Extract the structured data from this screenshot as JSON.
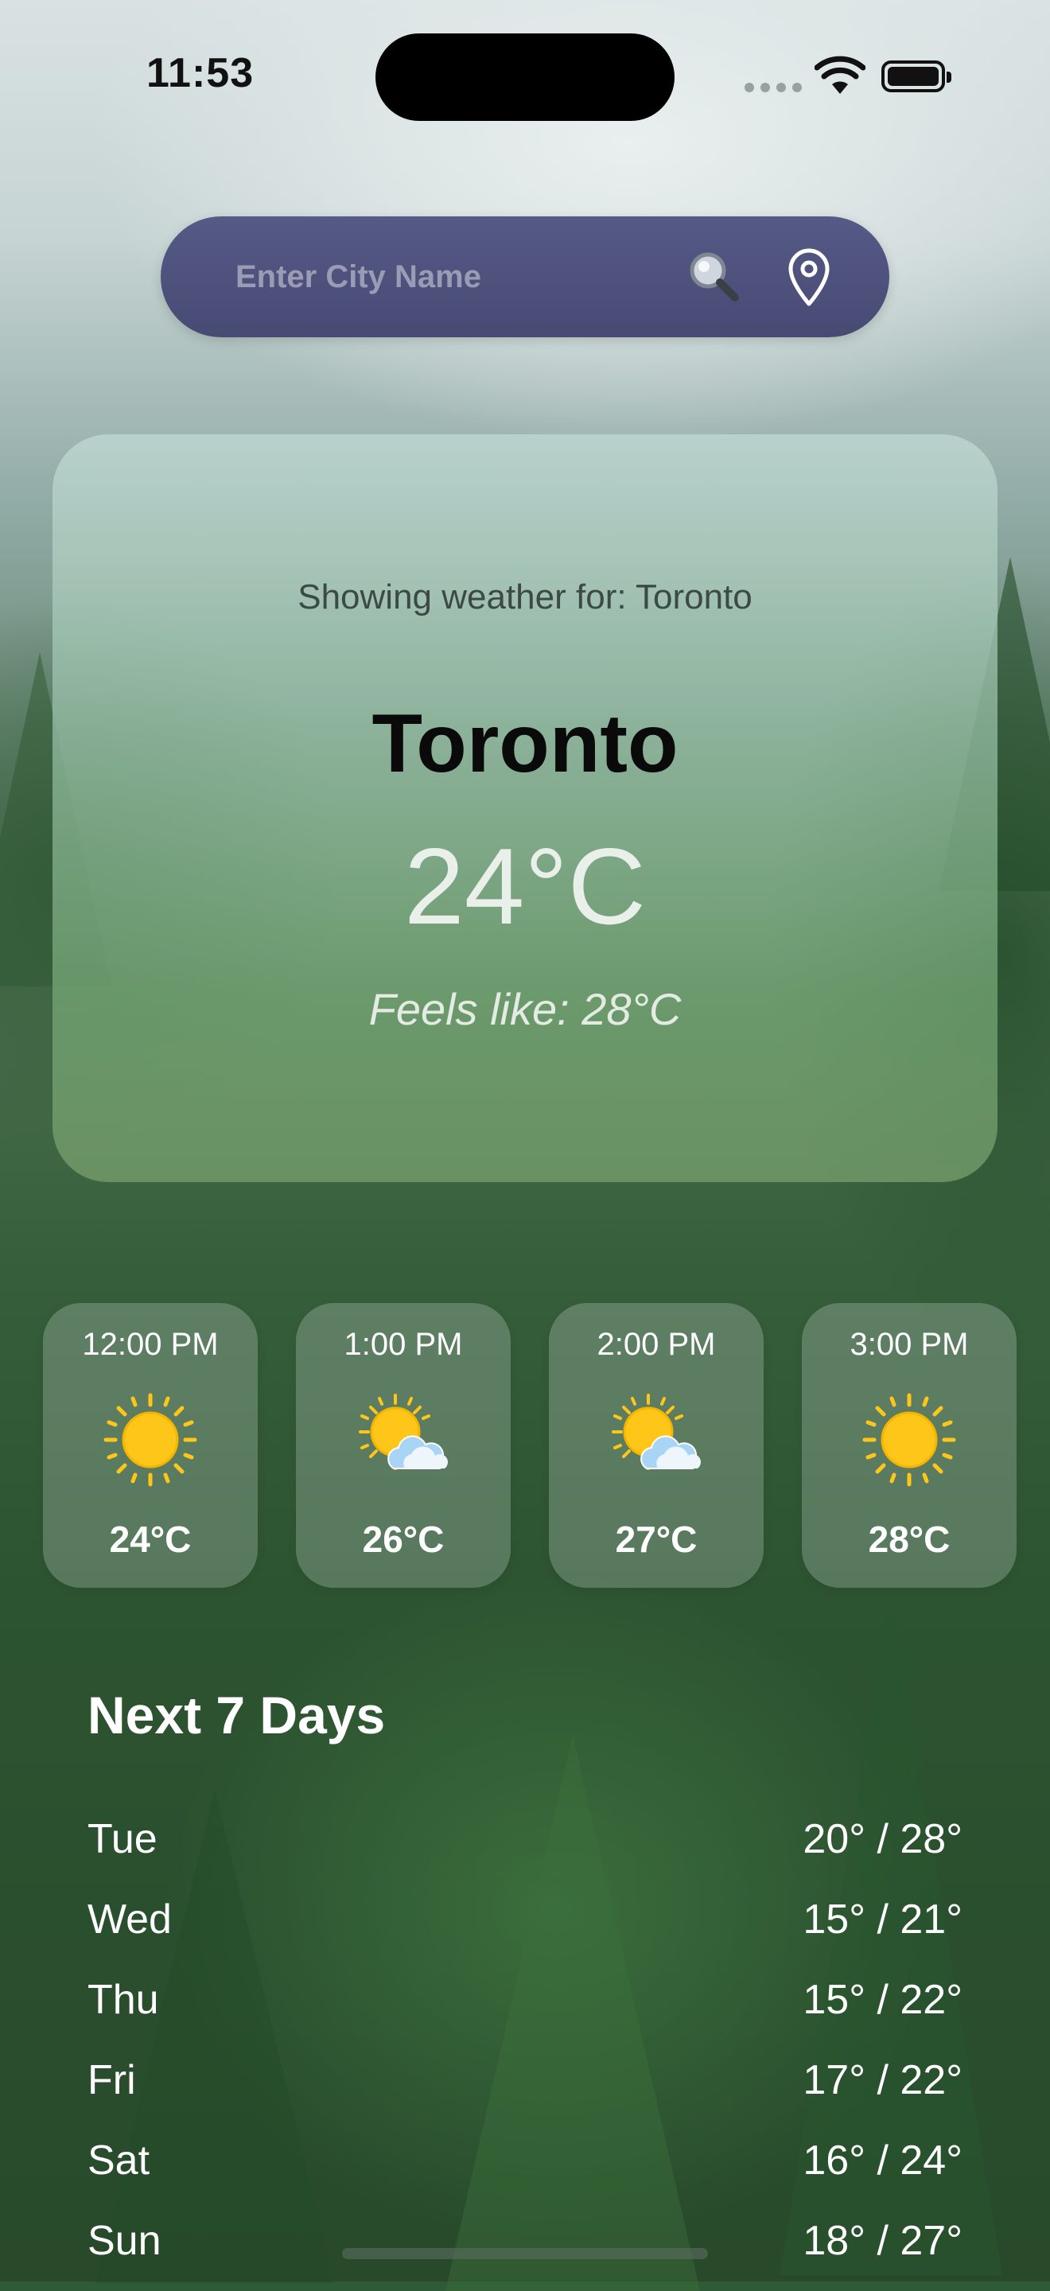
{
  "status_bar": {
    "time": "11:53"
  },
  "search": {
    "placeholder": "Enter City Name",
    "value": ""
  },
  "current": {
    "showing_text": "Showing weather for: Toronto",
    "city": "Toronto",
    "temperature": "24°C",
    "feels_like": "Feels like: 28°C"
  },
  "hourly": [
    {
      "time": "12:00 PM",
      "icon": "sun-icon",
      "temp": "24°C"
    },
    {
      "time": "1:00 PM",
      "icon": "partly-cloudy-icon",
      "temp": "26°C"
    },
    {
      "time": "2:00 PM",
      "icon": "partly-cloudy-icon",
      "temp": "27°C"
    },
    {
      "time": "3:00 PM",
      "icon": "sun-icon",
      "temp": "28°C"
    }
  ],
  "daily": {
    "title": "Next 7 Days",
    "days": [
      {
        "day": "Tue",
        "range": "20° / 28°"
      },
      {
        "day": "Wed",
        "range": "15° / 21°"
      },
      {
        "day": "Thu",
        "range": "15° / 22°"
      },
      {
        "day": "Fri",
        "range": "17° / 22°"
      },
      {
        "day": "Sat",
        "range": "16° / 24°"
      },
      {
        "day": "Sun",
        "range": "18° / 27°"
      }
    ]
  },
  "colors": {
    "search_bar": "#4f537e",
    "sun": "#ffc61a",
    "cloud": "#a8d4f5",
    "text_light": "#ffffff"
  }
}
